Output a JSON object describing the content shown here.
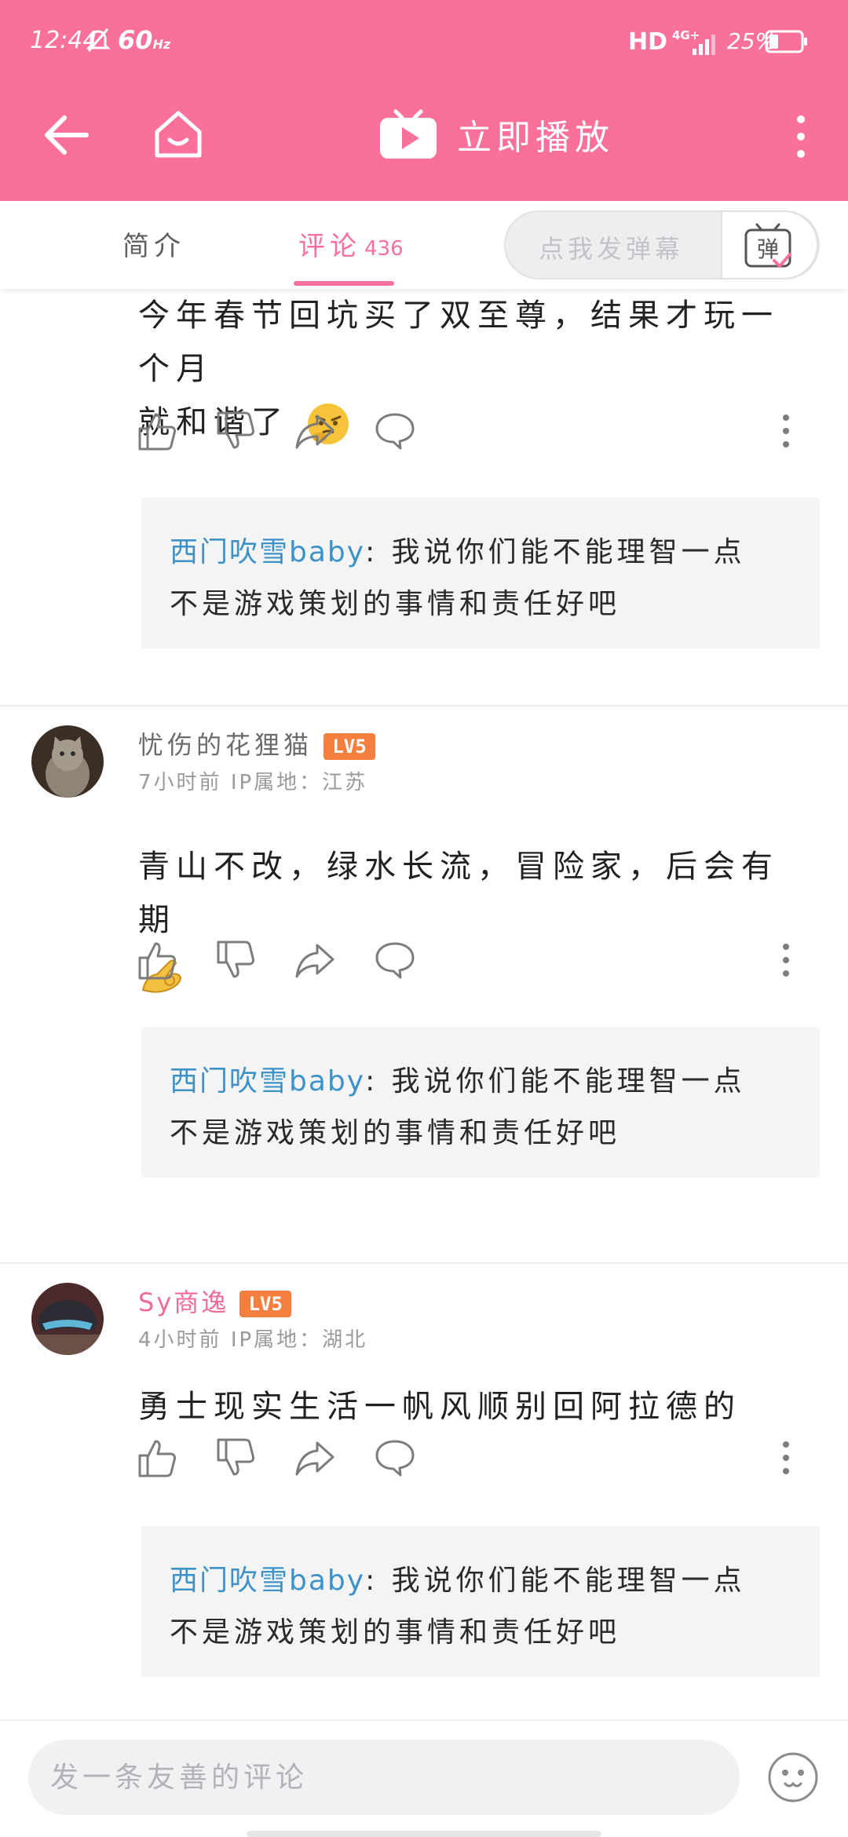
{
  "status_bar": {
    "time": "12:44",
    "refresh_rate": "60",
    "refresh_unit": "Hz",
    "hd": "HD",
    "network": "4G+",
    "battery": "25%"
  },
  "title_bar": {
    "play_label": "立即播放",
    "accent_color": "#f9719a"
  },
  "tabs": [
    {
      "label": "简介",
      "active": false
    },
    {
      "label": "评论",
      "count": "436",
      "active": true
    }
  ],
  "danmaku": {
    "placeholder": "点我发弹幕",
    "button_glyph": "弹"
  },
  "comments": [
    {
      "body_line1": "今年春节回坑买了双至尊，结果才玩一个月",
      "body_line2": "就和谐了",
      "emoji": "thinking-face-emoji",
      "reply": {
        "user": "西门吹雪baby",
        "line1_text": ": 我说你们能不能理智一点",
        "line2_text": "不是游戏策划的事情和责任好吧"
      }
    },
    {
      "username": "忧伤的花狸猫",
      "level": "LV5",
      "time": "7小时前",
      "ip": "IP属地：江苏",
      "body_line1": "青山不改，绿水长流，冒险家，后会有期",
      "emoji": "ok-hand-emoji",
      "reply": {
        "user": "西门吹雪baby",
        "line1_text": ": 我说你们能不能理智一点",
        "line2_text": "不是游戏策划的事情和责任好吧"
      }
    },
    {
      "username": "Sy商逸",
      "level": "LV5",
      "time": "4小时前",
      "ip": "IP属地：湖北",
      "body_line1": "勇士现实生活一帆风顺别回阿拉德的",
      "reply": {
        "user": "西门吹雪baby",
        "line1_text": ": 我说你们能不能理智一点",
        "line2_text": "不是游戏策划的事情和责任好吧"
      }
    }
  ],
  "bottom_bar": {
    "input_placeholder": "发一条友善的评论"
  }
}
